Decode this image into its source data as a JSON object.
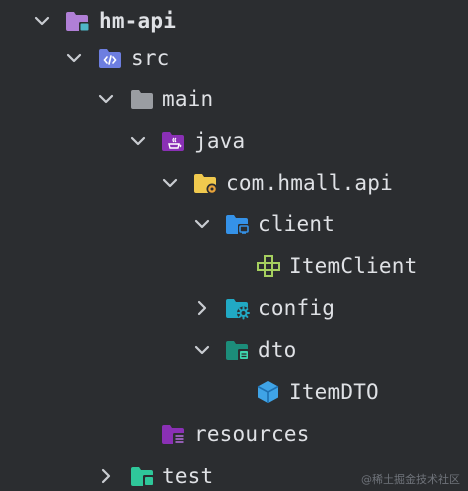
{
  "tree": {
    "items": [
      {
        "label": "hm-api",
        "icon": "module-folder-icon",
        "expanded": true
      },
      {
        "label": "src",
        "icon": "source-folder-icon",
        "expanded": true
      },
      {
        "label": "main",
        "icon": "folder-icon",
        "expanded": true
      },
      {
        "label": "java",
        "icon": "java-source-root-icon",
        "expanded": true
      },
      {
        "label": "com.hmall.api",
        "icon": "package-folder-icon",
        "expanded": true
      },
      {
        "label": "client",
        "icon": "client-package-icon",
        "expanded": true
      },
      {
        "label": "ItemClient",
        "icon": "interface-class-icon"
      },
      {
        "label": "config",
        "icon": "config-package-icon",
        "expanded": false
      },
      {
        "label": "dto",
        "icon": "dto-package-icon",
        "expanded": true
      },
      {
        "label": "ItemDTO",
        "icon": "dto-class-icon"
      },
      {
        "label": "resources",
        "icon": "resources-root-icon"
      },
      {
        "label": "test",
        "icon": "test-root-icon",
        "expanded": false
      }
    ]
  },
  "colors": {
    "background": "#2b2d30",
    "text": "#dfe1e5",
    "chevron": "#c9ccd1",
    "module_purple": "#b07fd6",
    "source_blue": "#6d7ee0",
    "folder_gray": "#9a9da2",
    "java_purple": "#8a30b5",
    "package_yellow": "#f0c94e",
    "package_blue": "#3592e8",
    "interface_green": "#a6d05f",
    "dto_teal": "#1c8d7a",
    "dto_class_blue": "#3fa3e6",
    "test_green": "#2fc79a"
  },
  "watermark": "@稀土掘金技术社区"
}
